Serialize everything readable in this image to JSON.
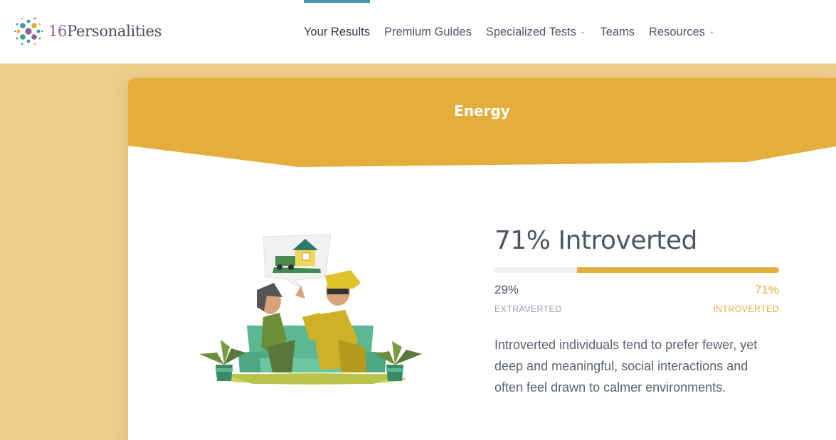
{
  "brand": {
    "number": "16",
    "name": "Personalities"
  },
  "nav": {
    "items": [
      {
        "label": "Your Results",
        "active": true,
        "dropdown": false
      },
      {
        "label": "Premium Guides",
        "active": false,
        "dropdown": false
      },
      {
        "label": "Specialized Tests",
        "active": false,
        "dropdown": true
      },
      {
        "label": "Teams",
        "active": false,
        "dropdown": false
      },
      {
        "label": "Resources",
        "active": false,
        "dropdown": true
      }
    ]
  },
  "section": {
    "title": "Energy",
    "result_title": "71% Introverted",
    "left_percent": "29%",
    "right_percent": "71%",
    "left_label": "EXTRAVERTED",
    "right_label": "INTROVERTED",
    "introverted_fraction": 0.71,
    "description": "Introverted individuals tend to prefer fewer, yet deep and meaningful, social interactions and often feel drawn to calmer environments."
  },
  "colors": {
    "accent": "#e3ae3b",
    "nav_active": "#4298b4",
    "background": "#edcd8a",
    "text": "#4c5565"
  }
}
